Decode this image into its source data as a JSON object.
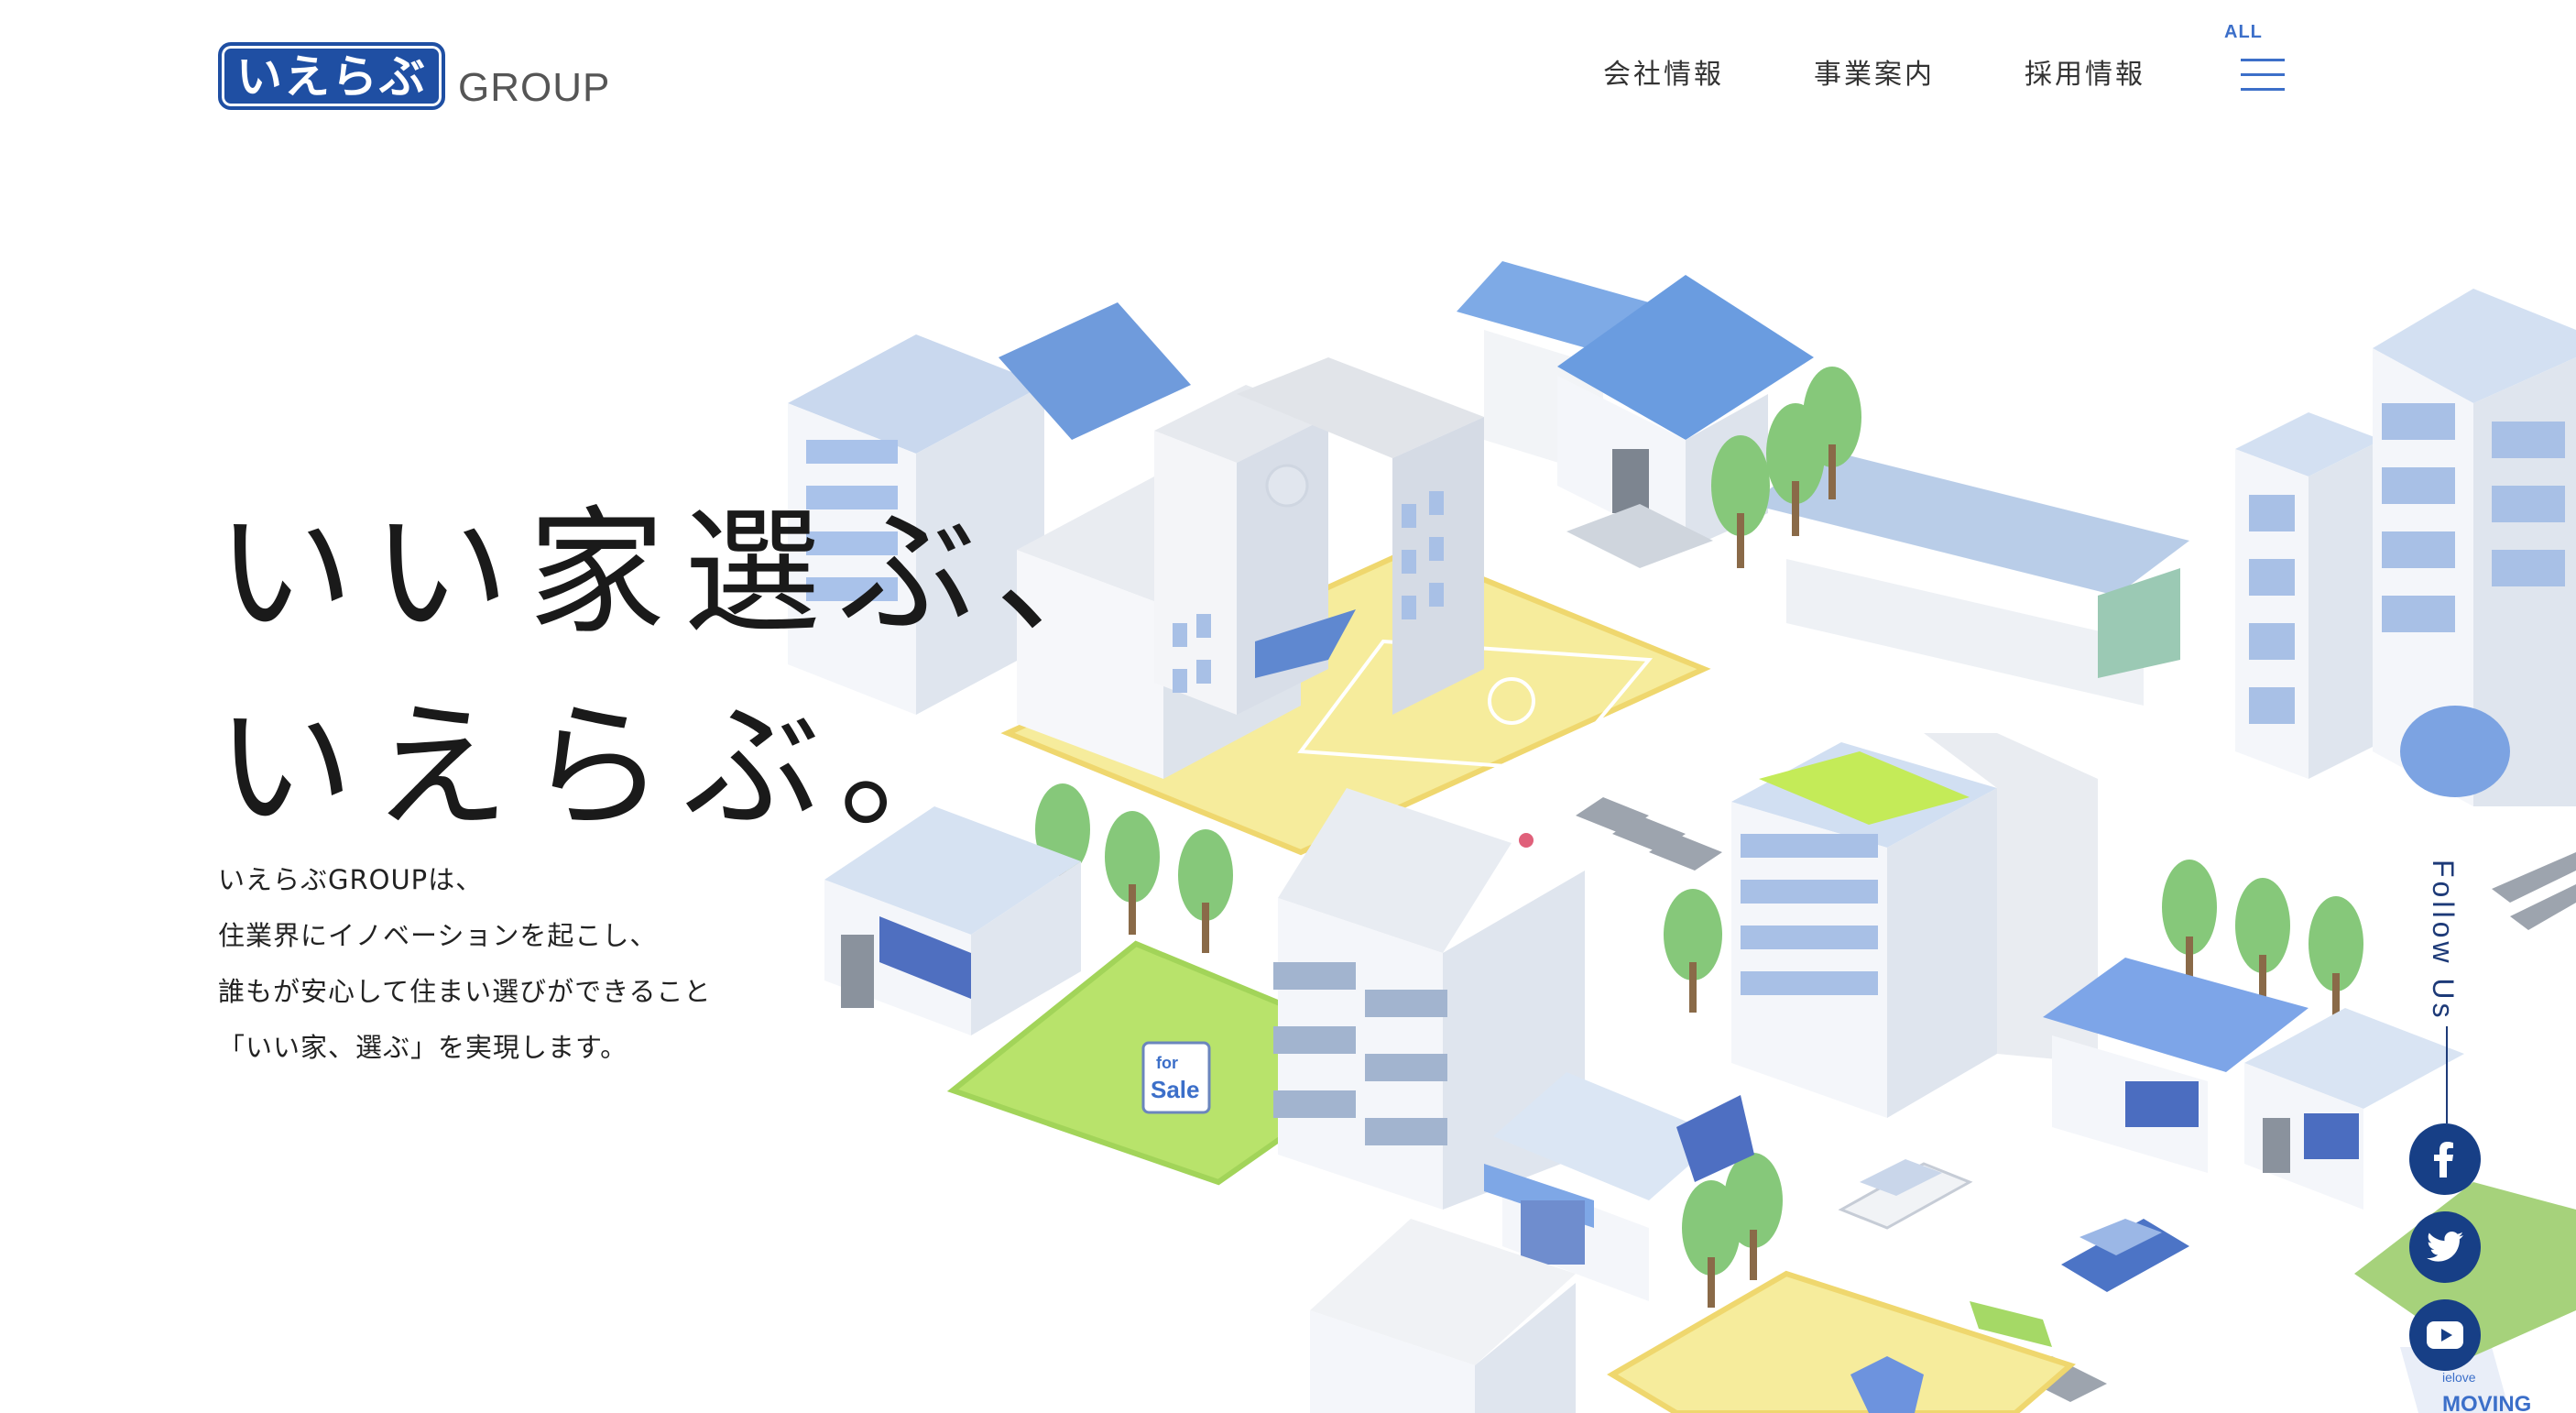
{
  "logo": {
    "mark": "いえらぶ",
    "group": "GROUP"
  },
  "nav": {
    "items": [
      {
        "label": "会社情報"
      },
      {
        "label": "事業案内"
      },
      {
        "label": "採用情報"
      }
    ],
    "menu_label": "ALL",
    "menu_icon": "hamburger-icon"
  },
  "hero": {
    "catch_line1": "いい家選ぶ、",
    "catch_line2": "いえらぶ。",
    "lead": [
      "いえらぶGROUPは、",
      "住業界にイノベーションを起こし、",
      "誰もが安心して住まい選びができること",
      "「いい家、選ぶ」を実現します。"
    ]
  },
  "illustration": {
    "sign_line1": "for",
    "sign_line2": "Sale",
    "truck_line1": "ielove",
    "truck_line2": "MOVING"
  },
  "follow": {
    "label": "Follow Us",
    "links": [
      {
        "name": "facebook",
        "icon": "facebook-icon"
      },
      {
        "name": "twitter",
        "icon": "twitter-icon"
      },
      {
        "name": "youtube",
        "icon": "youtube-icon"
      }
    ]
  },
  "colors": {
    "brand": "#1f4fa3",
    "accent": "#3c6fc9",
    "sns": "#173f86",
    "grass": "#b8e36b",
    "sand": "#f5ea9a"
  }
}
